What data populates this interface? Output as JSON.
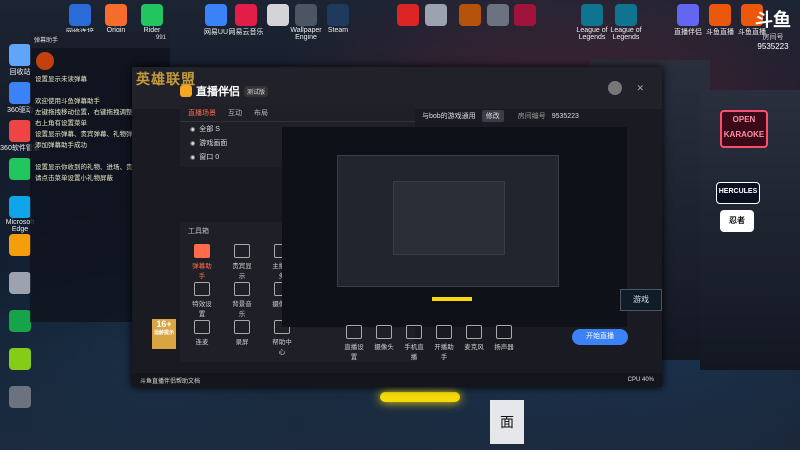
{
  "desktop": {
    "top_icons": [
      {
        "label": "网络连接",
        "color": "#2a6bd8"
      },
      {
        "label": "Origin",
        "color": "#f56c2d"
      },
      {
        "label": "Rider",
        "color": "#22c55e"
      },
      {
        "label": "网易UU",
        "color": "#3b82f6"
      },
      {
        "label": "网易云音乐",
        "color": "#e11d48"
      },
      {
        "label": "",
        "color": "#d4d4d8"
      },
      {
        "label": "Wallpaper Engine",
        "color": "#4b5563"
      },
      {
        "label": "Steam",
        "color": "#1e3a5f"
      },
      {
        "label": "",
        "color": "#dc2626"
      },
      {
        "label": "",
        "color": "#9ca3af"
      },
      {
        "label": "",
        "color": "#b45309"
      },
      {
        "label": "",
        "color": "#6b7280"
      },
      {
        "label": "",
        "color": "#9f1239"
      },
      {
        "label": "League of Legends",
        "color": "#0e7490"
      },
      {
        "label": "League of Legends",
        "color": "#0e7490"
      },
      {
        "label": "直播伴侣",
        "color": "#6366f1"
      },
      {
        "label": "斗鱼直播",
        "color": "#ea580c"
      },
      {
        "label": "斗鱼直播",
        "color": "#ea580c"
      }
    ],
    "left_icons": [
      {
        "label": "回收站",
        "color": "#60a5fa"
      },
      {
        "label": "360驱动",
        "color": "#3b82f6"
      },
      {
        "label": "360软件管家",
        "color": "#ef4444"
      },
      {
        "label": "",
        "color": "#22c55e"
      },
      {
        "label": "Microsoft Edge",
        "color": "#0ea5e9"
      },
      {
        "label": "",
        "color": "#f59e0b"
      },
      {
        "label": "",
        "color": "#9ca3af"
      },
      {
        "label": "",
        "color": "#16a34a"
      },
      {
        "label": "",
        "color": "#84cc16"
      },
      {
        "label": "",
        "color": "#6b7280"
      }
    ]
  },
  "douyu_badge": {
    "logo": "斗鱼",
    "room_label": "房间号",
    "room_id": "9535223"
  },
  "chat_panel": {
    "header_left": "弹幕助手",
    "header_right": "991",
    "lines": [
      "设置显示未读弹幕",
      "",
      "欢迎使用斗鱼弹幕助手",
      "左键拖拽移动位置，右键拖拽调整大小",
      "右上角有设置菜单",
      "设置显示弹幕、贵宾弹幕、礼物弹幕等",
      "添加弹幕助手成功",
      "",
      "设置显示你收到的礼物、进场、贵宾开通",
      "请点击菜单设置小礼物屏蔽"
    ]
  },
  "app": {
    "logo": "英雄联盟",
    "title": "直播伴侣",
    "badge": "测试版",
    "tabs": [
      {
        "label": "直播场景"
      },
      {
        "label": "互动"
      },
      {
        "label": "布局"
      }
    ],
    "scenes": [
      {
        "label": "全部 S"
      },
      {
        "label": "游戏画面"
      },
      {
        "label": "窗口 0"
      }
    ],
    "stream_title": "与bob的游戏通用",
    "edit_label": "修改",
    "room_label": "房间编号",
    "room_value": "9535223",
    "tools_heading": "工具箱",
    "tools": [
      {
        "label": "弹幕助手"
      },
      {
        "label": "贵宾显示"
      },
      {
        "label": "主播任务"
      },
      {
        "label": "特效设置"
      },
      {
        "label": "背景音乐"
      },
      {
        "label": "摄像头"
      },
      {
        "label": "连麦"
      },
      {
        "label": "录屏"
      },
      {
        "label": "帮助中心"
      }
    ],
    "age_label": "16+",
    "age_caption": "适龄提示",
    "bottom_tools": [
      {
        "label": "直播设置"
      },
      {
        "label": "摄像头"
      },
      {
        "label": "手机直播"
      },
      {
        "label": "开播助手"
      },
      {
        "label": "麦克风"
      },
      {
        "label": "扬声器"
      }
    ],
    "start_button": "开始直播",
    "footer_left": "斗鱼直播伴侣帮助文档",
    "footer_right": "CPU 40%",
    "game_button": "游戏"
  }
}
